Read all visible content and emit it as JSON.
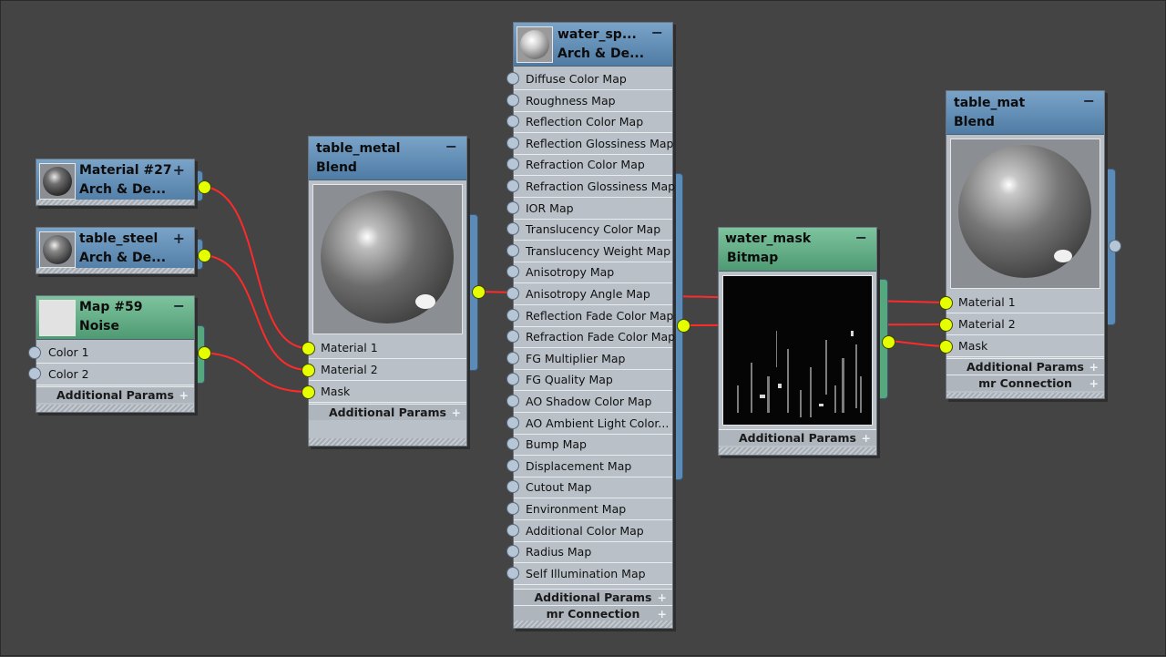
{
  "nodes": {
    "material27": {
      "title": "Material #27",
      "subtitle": "Arch & De..."
    },
    "table_steel": {
      "title": "table_steel",
      "subtitle": "Arch & De..."
    },
    "map59": {
      "title": "Map #59",
      "subtitle": "Noise",
      "inputs": [
        "Color 1",
        "Color 2"
      ],
      "bars": [
        "Additional Params"
      ]
    },
    "table_metal": {
      "title": "table_metal",
      "subtitle": "Blend",
      "inputs": [
        "Material 1",
        "Material 2",
        "Mask"
      ],
      "bars": [
        "Additional Params"
      ]
    },
    "water_sp": {
      "title": "water_sp...",
      "subtitle": "Arch & De...",
      "inputs": [
        "Diffuse Color Map",
        "Roughness Map",
        "Reflection Color Map",
        "Reflection Glossiness Map",
        "Refraction Color Map",
        "Refraction Glossiness Map",
        "IOR Map",
        "Translucency Color Map",
        "Translucency Weight Map",
        "Anisotropy Map",
        "Anisotropy Angle Map",
        "Reflection Fade Color Map",
        "Refraction Fade Color Map",
        "FG Multiplier Map",
        "FG Quality Map",
        "AO Shadow Color Map",
        "AO Ambient Light Color...",
        "Bump Map",
        "Displacement Map",
        "Cutout Map",
        "Environment Map",
        "Additional Color Map",
        "Radius Map",
        "Self Illumination Map"
      ],
      "bars": [
        "Additional Params",
        "mr Connection"
      ]
    },
    "water_mask": {
      "title": "water_mask",
      "subtitle": "Bitmap",
      "bars": [
        "Additional Params"
      ]
    },
    "table_mat": {
      "title": "table_mat",
      "subtitle": "Blend",
      "inputs": [
        "Material 1",
        "Material 2",
        "Mask"
      ],
      "bars": [
        "Additional Params",
        "mr Connection"
      ]
    }
  },
  "icons": {
    "collapse": "−",
    "expand": "+"
  },
  "colors": {
    "background": "#444444",
    "wire": "#ff2a2a",
    "socket_connected": "#e5ff00",
    "header_material": "#5f8db5",
    "header_map": "#5daa80",
    "node_body": "#b9c0c8"
  }
}
